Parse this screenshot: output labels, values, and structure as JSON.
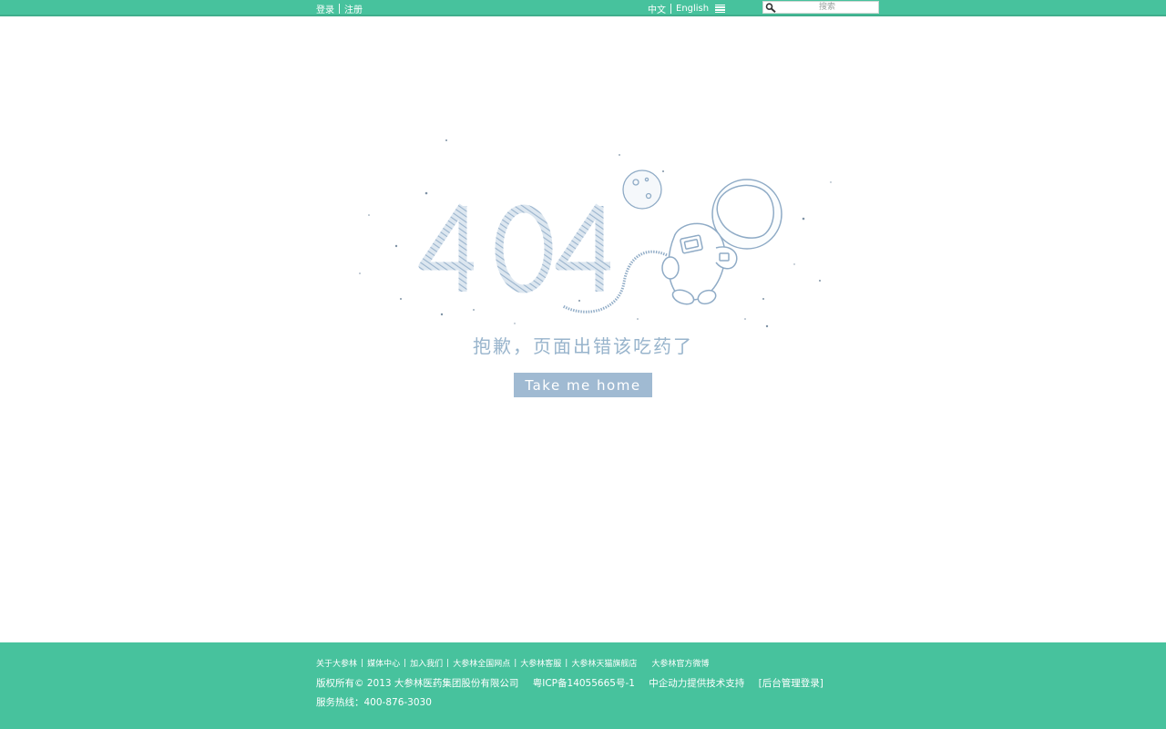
{
  "topbar": {
    "login": "登录",
    "register": "注册",
    "lang_cn": "中文",
    "lang_en": "English",
    "search_placeholder": "搜索"
  },
  "main": {
    "error_code": "404",
    "message": "抱歉，页面出错该吃药了",
    "home_button": "Take me home"
  },
  "footer": {
    "links": [
      "关于大参林",
      "媒体中心",
      "加入我们",
      "大参林全国网点",
      "大参林客服",
      "大参林天猫旗舰店"
    ],
    "weibo": "大参林官方微博",
    "copyright": "版权所有© 2013 大参林医药集团股份有限公司",
    "icp": "粤ICP备14055665号-1",
    "support": "中企动力提供技术支持",
    "admin_login": "[后台管理登录]",
    "hotline": "服务热线：400-876-3030"
  },
  "colors": {
    "brand_green": "#47c29d",
    "accent_blue": "#98b4cc",
    "button_blue": "#a0bad2"
  }
}
